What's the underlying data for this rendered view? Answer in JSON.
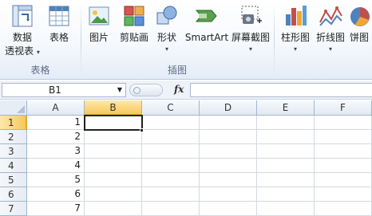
{
  "ribbon": {
    "groups": [
      {
        "label": "表格",
        "buttons": [
          {
            "label_line1": "数据",
            "label_line2": "透视表",
            "icon": "pivot-table-icon"
          },
          {
            "label_line1": "表格",
            "icon": "table-icon"
          }
        ]
      },
      {
        "label": "插图",
        "buttons": [
          {
            "label_line1": "图片",
            "icon": "picture-icon"
          },
          {
            "label_line1": "剪贴画",
            "icon": "clip-art-icon"
          },
          {
            "label_line1": "形状",
            "icon": "shapes-icon"
          },
          {
            "label_line1": "SmartArt",
            "icon": "smartart-icon"
          },
          {
            "label_line1": "屏幕截图",
            "icon": "screenshot-icon"
          }
        ]
      },
      {
        "label": "",
        "buttons": [
          {
            "label_line1": "柱形图",
            "icon": "column-chart-icon"
          },
          {
            "label_line1": "折线图",
            "icon": "line-chart-icon"
          },
          {
            "label_line1": "饼图",
            "icon": "pie-chart-icon"
          }
        ]
      }
    ]
  },
  "formula_bar": {
    "name_box": "B1",
    "fx_label": "fx",
    "formula": ""
  },
  "sheet": {
    "columns": [
      "A",
      "B",
      "C",
      "D",
      "E",
      "F"
    ],
    "selected_column": "B",
    "selected_row": "1",
    "rows": [
      {
        "num": "1",
        "A": "1"
      },
      {
        "num": "2",
        "A": "2"
      },
      {
        "num": "3",
        "A": "3"
      },
      {
        "num": "4",
        "A": "4"
      },
      {
        "num": "5",
        "A": "5"
      },
      {
        "num": "6",
        "A": "6"
      },
      {
        "num": "7",
        "A": "7"
      }
    ]
  },
  "colors": {
    "selection_header": "#f7c75d",
    "ribbon_bg": "#f6f9fd",
    "grid_line": "#d4d9e1"
  }
}
